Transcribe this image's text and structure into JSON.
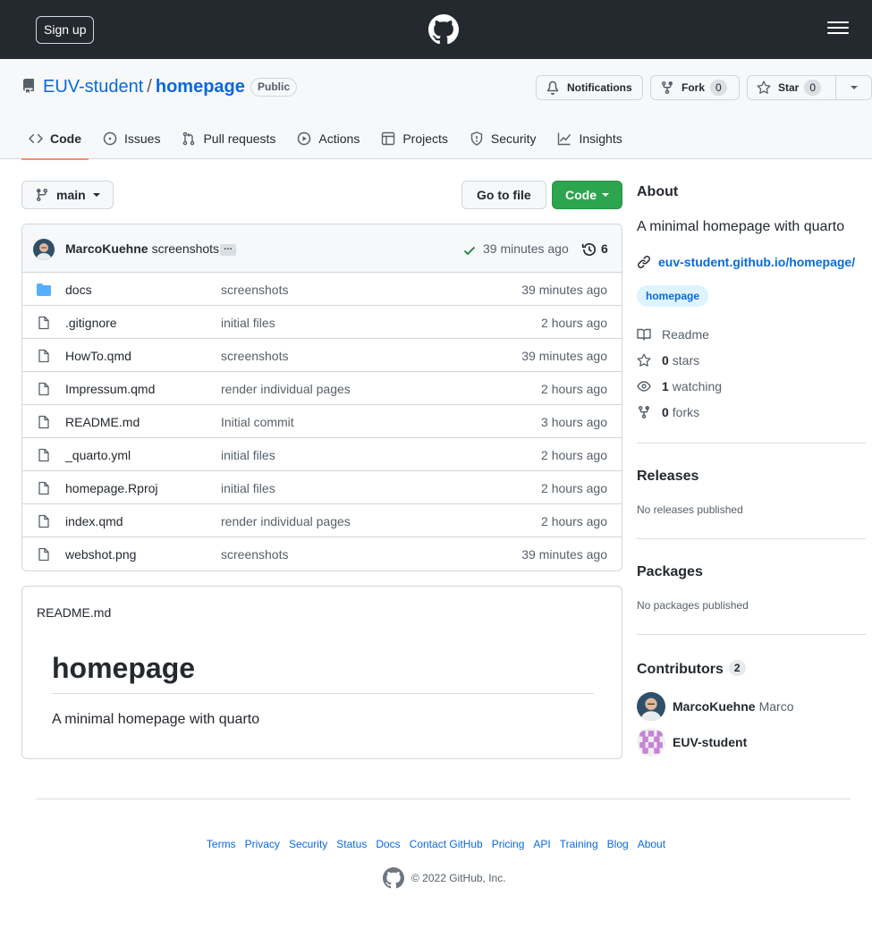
{
  "header": {
    "signup_label": "Sign up"
  },
  "repo": {
    "owner": "EUV-student",
    "separator": "/",
    "name": "homepage",
    "visibility": "Public",
    "notifications_label": "Notifications",
    "fork_label": "Fork",
    "fork_count": "0",
    "star_label": "Star",
    "star_count": "0"
  },
  "tabs": [
    {
      "label": "Code",
      "icon": "code-icon",
      "active": true
    },
    {
      "label": "Issues",
      "icon": "issue-icon"
    },
    {
      "label": "Pull requests",
      "icon": "pull-request-icon"
    },
    {
      "label": "Actions",
      "icon": "play-icon"
    },
    {
      "label": "Projects",
      "icon": "table-icon"
    },
    {
      "label": "Security",
      "icon": "shield-icon"
    },
    {
      "label": "Insights",
      "icon": "graph-icon"
    }
  ],
  "toolbar": {
    "branch": "main",
    "goto_file_label": "Go to file",
    "code_label": "Code"
  },
  "commit": {
    "author": "MarcoKuehne",
    "message": "screenshots",
    "ellipsis": "…",
    "time": "39 minutes ago",
    "count": "6"
  },
  "files": [
    {
      "name": "docs",
      "type": "folder",
      "message": "screenshots",
      "age": "39 minutes ago"
    },
    {
      "name": ".gitignore",
      "type": "file",
      "message": "initial files",
      "age": "2 hours ago"
    },
    {
      "name": "HowTo.qmd",
      "type": "file",
      "message": "screenshots",
      "age": "39 minutes ago"
    },
    {
      "name": "Impressum.qmd",
      "type": "file",
      "message": "render individual pages",
      "age": "2 hours ago"
    },
    {
      "name": "README.md",
      "type": "file",
      "message": "Initial commit",
      "age": "3 hours ago"
    },
    {
      "name": "_quarto.yml",
      "type": "file",
      "message": "initial files",
      "age": "2 hours ago"
    },
    {
      "name": "homepage.Rproj",
      "type": "file",
      "message": "initial files",
      "age": "2 hours ago"
    },
    {
      "name": "index.qmd",
      "type": "file",
      "message": "render individual pages",
      "age": "2 hours ago"
    },
    {
      "name": "webshot.png",
      "type": "file",
      "message": "screenshots",
      "age": "39 minutes ago"
    }
  ],
  "readme": {
    "filename": "README.md",
    "heading": "homepage",
    "text": "A minimal homepage with quarto"
  },
  "about": {
    "heading": "About",
    "description": "A minimal homepage with quarto",
    "link": "euv-student.github.io/homepage/",
    "topic": "homepage",
    "readme_label": "Readme",
    "stars_count": "0",
    "stars_label": "stars",
    "watching_count": "1",
    "watching_label": "watching",
    "forks_count": "0",
    "forks_label": "forks"
  },
  "releases": {
    "heading": "Releases",
    "text": "No releases published"
  },
  "packages": {
    "heading": "Packages",
    "text": "No packages published"
  },
  "contributors": {
    "heading": "Contributors",
    "count": "2",
    "list": [
      {
        "login": "MarcoKuehne",
        "name": "Marco"
      },
      {
        "login": "EUV-student",
        "name": ""
      }
    ]
  },
  "footer": {
    "links": [
      "Terms",
      "Privacy",
      "Security",
      "Status",
      "Docs",
      "Contact GitHub",
      "Pricing",
      "API",
      "Training",
      "Blog",
      "About"
    ],
    "copyright": "© 2022 GitHub, Inc."
  },
  "colors": {
    "header_bg": "#24292f",
    "link_blue": "#0969da",
    "code_button_green": "#2da44e",
    "active_tab_underline": "#fd8c73",
    "folder_blue": "#54aeff"
  }
}
